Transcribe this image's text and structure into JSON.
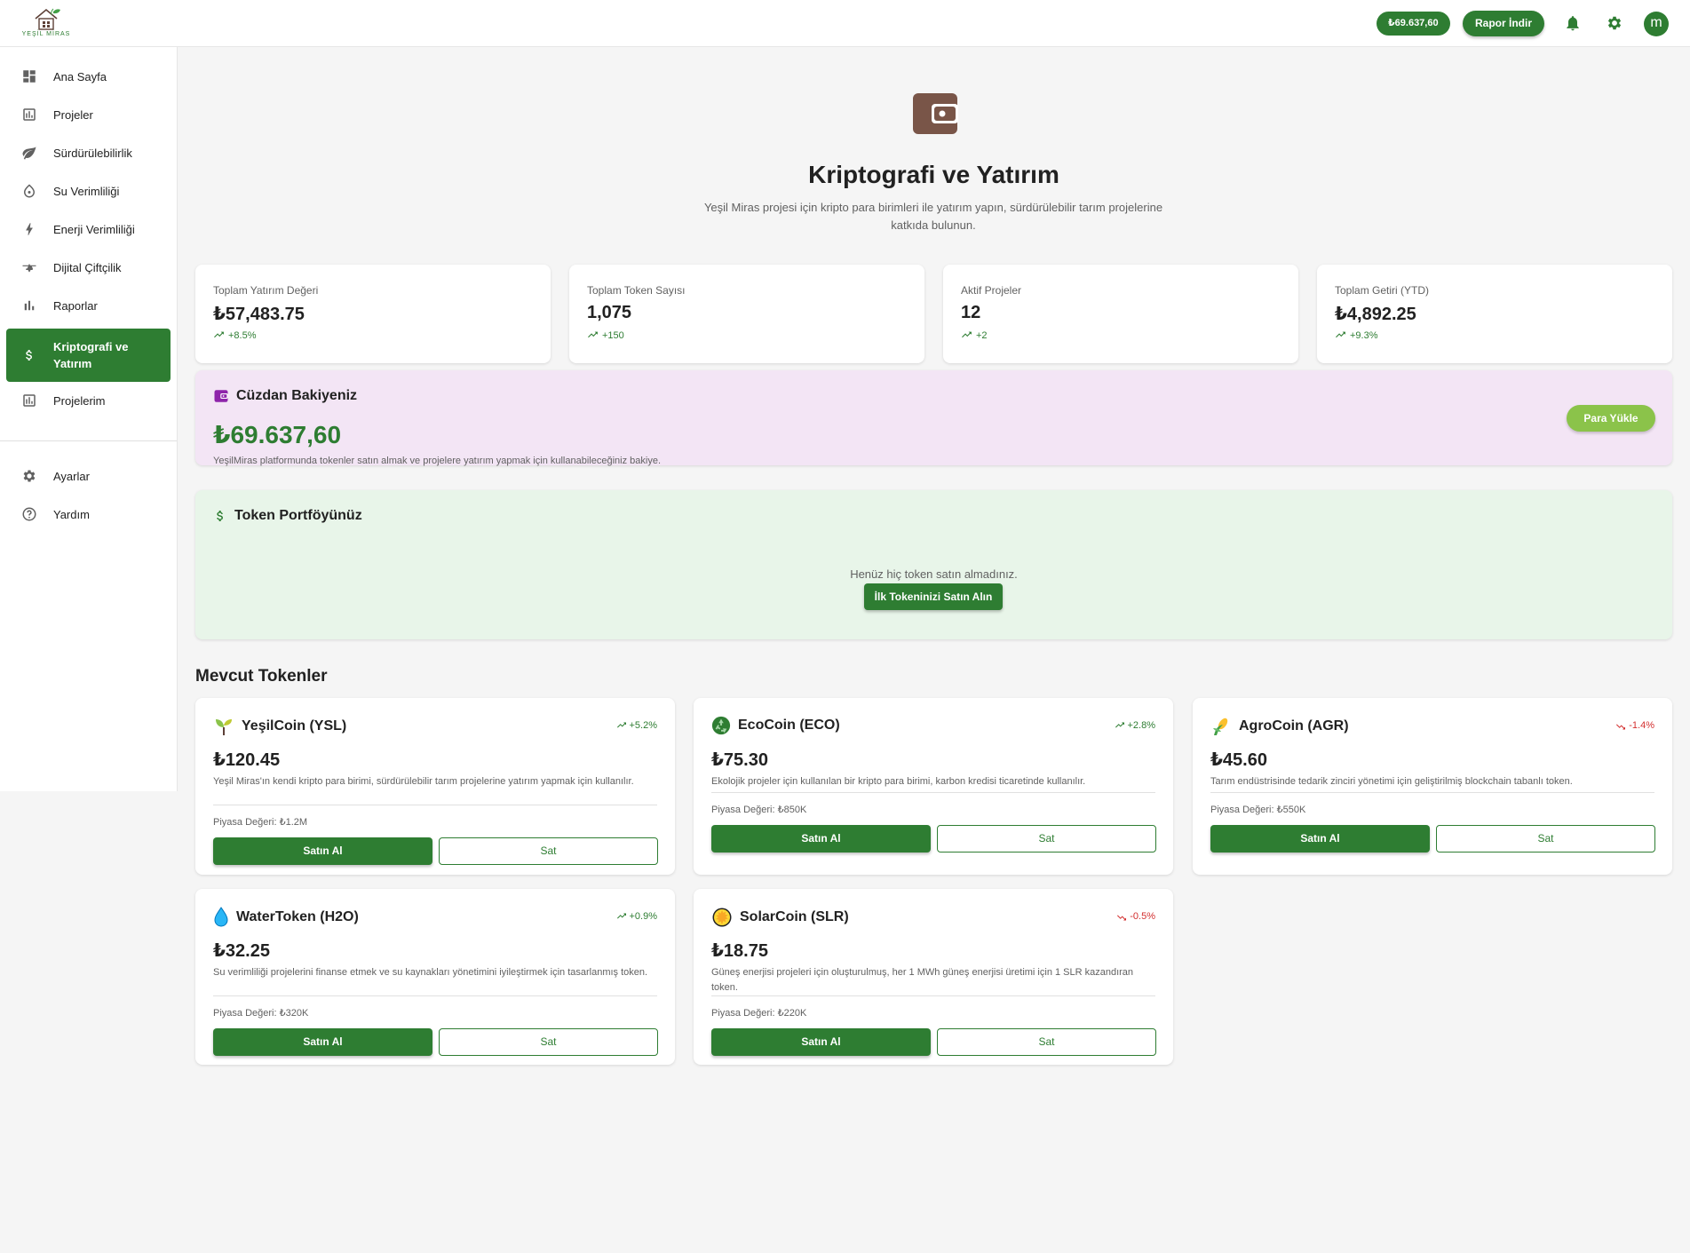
{
  "header": {
    "logo_text": "YEŞİL MİRAS",
    "balance": "₺69.637,60",
    "report_label": "Rapor İndir",
    "avatar_letter": "m"
  },
  "sidebar": {
    "items": [
      {
        "label": "Ana Sayfa",
        "icon": "dashboard-icon"
      },
      {
        "label": "Projeler",
        "icon": "chart-box-icon"
      },
      {
        "label": "Sürdürülebilirlik",
        "icon": "leaf-icon"
      },
      {
        "label": "Su Verimliliği",
        "icon": "water-drop-icon"
      },
      {
        "label": "Enerji Verimliliği",
        "icon": "bolt-icon"
      },
      {
        "label": "Dijital Çiftçilik",
        "icon": "drone-icon"
      },
      {
        "label": "Raporlar",
        "icon": "bar-chart-icon"
      },
      {
        "label": "Kriptografi ve Yatırım",
        "icon": "dollar-icon",
        "active": true
      },
      {
        "label": "Projelerim",
        "icon": "chart-box-icon"
      }
    ],
    "bottom_items": [
      {
        "label": "Ayarlar",
        "icon": "gear-icon"
      },
      {
        "label": "Yardım",
        "icon": "help-icon"
      }
    ]
  },
  "hero": {
    "title": "Kriptografi ve Yatırım",
    "subtitle": "Yeşil Miras projesi için kripto para birimleri ile yatırım yapın, sürdürülebilir tarım projelerine katkıda bulunun."
  },
  "stats": [
    {
      "label": "Toplam Yatırım Değeri",
      "value": "₺57,483.75",
      "change": "+8.5%"
    },
    {
      "label": "Toplam Token Sayısı",
      "value": "1,075",
      "change": "+150"
    },
    {
      "label": "Aktif Projeler",
      "value": "12",
      "change": "+2"
    },
    {
      "label": "Toplam Getiri (YTD)",
      "value": "₺4,892.25",
      "change": "+9.3%"
    }
  ],
  "wallet": {
    "title": "Cüzdan Bakiyeniz",
    "amount": "₺69.637,60",
    "description": "YeşilMiras platformunda tokenler satın almak ve projelere yatırım yapmak için kullanabileceğiniz bakiye.",
    "button": "Para Yükle"
  },
  "portfolio": {
    "title": "Token Portföyünüz",
    "empty_text": "Henüz hiç token satın almadınız.",
    "button": "İlk Tokeninizi Satın Alın"
  },
  "tokens_section": {
    "title": "Mevcut Tokenler",
    "buy_label": "Satın Al",
    "sell_label": "Sat",
    "tokens": [
      {
        "name": "YeşilCoin (YSL)",
        "icon": "sprout-icon",
        "change": "+5.2%",
        "direction": "up",
        "price": "₺120.45",
        "description": "Yeşil Miras'ın kendi kripto para birimi, sürdürülebilir tarım projelerine yatırım yapmak için kullanılır.",
        "market_cap": "Piyasa Değeri: ₺1.2M"
      },
      {
        "name": "EcoCoin (ECO)",
        "icon": "recycle-icon",
        "change": "+2.8%",
        "direction": "up",
        "price": "₺75.30",
        "description": "Ekolojik projeler için kullanılan bir kripto para birimi, karbon kredisi ticaretinde kullanılır.",
        "market_cap": "Piyasa Değeri: ₺850K"
      },
      {
        "name": "AgroCoin (AGR)",
        "icon": "corn-icon",
        "change": "-1.4%",
        "direction": "down",
        "price": "₺45.60",
        "description": "Tarım endüstrisinde tedarik zinciri yönetimi için geliştirilmiş blockchain tabanlı token.",
        "market_cap": "Piyasa Değeri: ₺550K"
      },
      {
        "name": "WaterToken (H2O)",
        "icon": "droplet-icon",
        "change": "+0.9%",
        "direction": "up",
        "price": "₺32.25",
        "description": "Su verimliliği projelerini finanse etmek ve su kaynakları yönetimini iyileştirmek için tasarlanmış token.",
        "market_cap": "Piyasa Değeri: ₺320K"
      },
      {
        "name": "SolarCoin (SLR)",
        "icon": "sun-icon",
        "change": "-0.5%",
        "direction": "down",
        "price": "₺18.75",
        "description": "Güneş enerjisi projeleri için oluşturulmuş, her 1 MWh güneş enerjisi üretimi için 1 SLR kazandıran token.",
        "market_cap": "Piyasa Değeri: ₺220K"
      }
    ]
  },
  "colors": {
    "primary": "#2e7d32",
    "accent_light": "#8bc34a",
    "wallet_bg": "#f3e5f5",
    "portfolio_bg": "#e8f5e9",
    "down": "#d32f2f"
  }
}
